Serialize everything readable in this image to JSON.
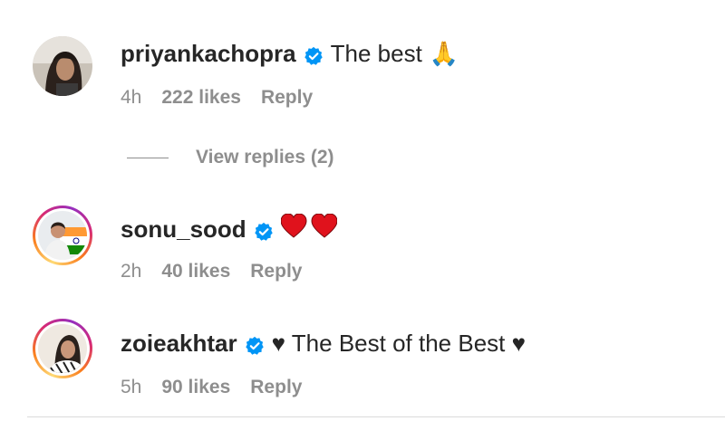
{
  "comments": [
    {
      "username": "priyankachopra",
      "text": "The best",
      "emoji": "🙏",
      "time": "4h",
      "likes": "222 likes",
      "reply": "Reply"
    },
    {
      "username": "sonu_sood",
      "text": "",
      "emoji": "❤️❤️",
      "time": "2h",
      "likes": "40 likes",
      "reply": "Reply"
    },
    {
      "username": "zoieakhtar",
      "text": "♥ The Best of the Best ♥",
      "emoji": "",
      "time": "5h",
      "likes": "90 likes",
      "reply": "Reply"
    }
  ],
  "view_replies": "View replies (2)",
  "icons": {
    "verified": "verified-badge-icon",
    "verified_color": "#0095f6"
  }
}
